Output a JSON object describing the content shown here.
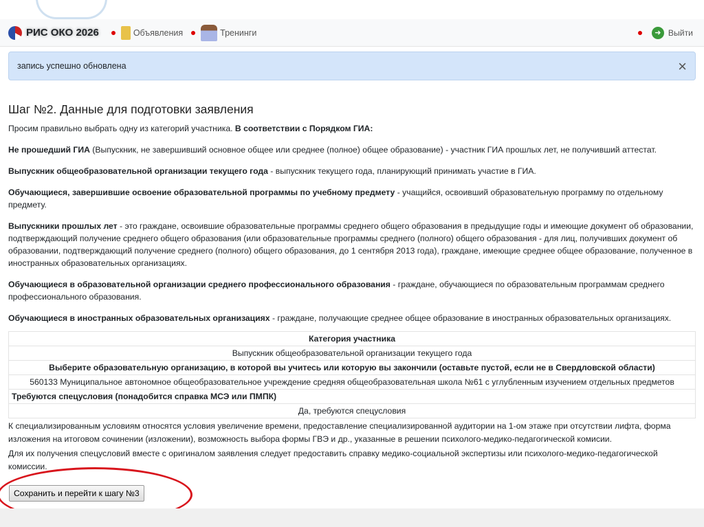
{
  "navbar": {
    "brand": "РИС ОКО 2026",
    "items": [
      {
        "label": "Объявления"
      },
      {
        "label": "Тренинги"
      }
    ],
    "logout": "Выйти"
  },
  "alert": {
    "text": "запись успешно обновлена",
    "close": "×"
  },
  "main": {
    "title": "Шаг №2. Данные для подготовки заявления",
    "intro": "Просим правильно выбрать одну из категорий участника. ",
    "intro_bold": "В соответствии с Порядком ГИА:",
    "categories": [
      {
        "term": "Не прошедший ГИА",
        "desc": " (Выпускник, не завершивший основное общее или среднее (полное) общее образование) - участник ГИА прошлых лет, не получивший аттестат."
      },
      {
        "term": "Выпускник общеобразовательной организации текущего года",
        "desc": " - выпускник текущего года, планирующий принимать участие в ГИА."
      },
      {
        "term": "Обучающиеся, завершившие освоение образовательной программы по учебному предмету",
        "desc": " - учащийся, освоивший образовательную программу по отдельному предмету."
      },
      {
        "term": "Выпускники прошлых лет",
        "desc": " - это граждане, освоившие образовательные программы среднего общего образования в предыдущие годы и имеющие документ об образовании, подтверждающий получение среднего общего образования (или образовательные программы среднего (полного) общего образования - для лиц, получивших документ об образовании, подтверждающий получение среднего (полного) общего образования, до 1 сентября 2013 года), граждане, имеющие среднее общее образование, полученное в иностранных образовательных организациях."
      },
      {
        "term": "Обучающиеся в образовательной организации среднего профессионального образования",
        "desc": " - граждане, обучающиеся по образовательным программам среднего профессионального образования."
      },
      {
        "term": "Обучающиеся в иностранных образовательных организациях",
        "desc": " - граждане, получающие среднее общее образование в иностранных образовательных организациях."
      }
    ],
    "table": {
      "category_header": "Категория участника",
      "category_value": "Выпускник общеобразовательной организации текущего года",
      "org_header": "Выберите образовательную организацию, в которой вы учитесь или которую вы закончили (оставьте пустой, если не в Свердловской области)",
      "org_value": "560133 Муниципальное автономное общеобразовательное учреждение средняя общеобразовательная школа №61 с углубленным изучением отдельных предметов",
      "special_header": "Требуются спецусловия (понадобится справка МСЭ или ПМПК)",
      "special_value": "Да, требуются спецусловия"
    },
    "note1": "К специализированным условиям относятся условия увеличение времени, предоставление специализированной аудитории на 1-ом этаже при отсутствии лифта, форма изложения на итоговом сочинении (изложении), возможность выбора формы ГВЭ и др., указанные в решении психолого-медико-педагогической комисии.",
    "note2": "Для их получения спецусловий вместе с оригиналом заявления следует предоставить справку медико-социальной экспертизы или психолого-медико-педагогической комиссии.",
    "submit": "Сохранить и перейти к шагу №3"
  }
}
